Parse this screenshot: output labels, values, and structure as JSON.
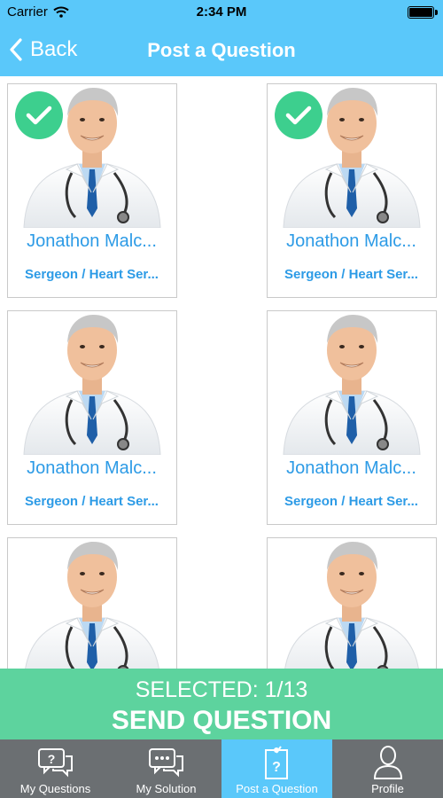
{
  "status_bar": {
    "carrier": "Carrier",
    "time": "2:34 PM"
  },
  "nav": {
    "back_label": "Back",
    "title": "Post a Question"
  },
  "doctors": [
    {
      "name": "Jonathon Malc...",
      "specialty": "Sergeon / Heart Ser...",
      "selected": true
    },
    {
      "name": "Jonathon Malc...",
      "specialty": "Sergeon / Heart Ser...",
      "selected": true
    },
    {
      "name": "Jonathon Malc...",
      "specialty": "Sergeon / Heart Ser...",
      "selected": false
    },
    {
      "name": "Jonathon Malc...",
      "specialty": "Sergeon / Heart Ser...",
      "selected": false
    },
    {
      "name": "",
      "specialty": "",
      "selected": false
    },
    {
      "name": "",
      "specialty": "",
      "selected": false
    }
  ],
  "send_bar": {
    "selected_text": "SELECTED: 1/13",
    "send_label": "SEND QUESTION"
  },
  "tabs": [
    {
      "label": "My Questions",
      "icon": "question-chat-icon",
      "active": false
    },
    {
      "label": "My Solution",
      "icon": "chat-dots-icon",
      "active": false
    },
    {
      "label": "Post a Question",
      "icon": "post-question-icon",
      "active": true
    },
    {
      "label": "Profile",
      "icon": "profile-icon",
      "active": false
    }
  ],
  "colors": {
    "primary": "#5ac8fa",
    "accent": "#5dd39e",
    "text_link": "#2d9be6",
    "tab_bar": "#6b6f72"
  }
}
